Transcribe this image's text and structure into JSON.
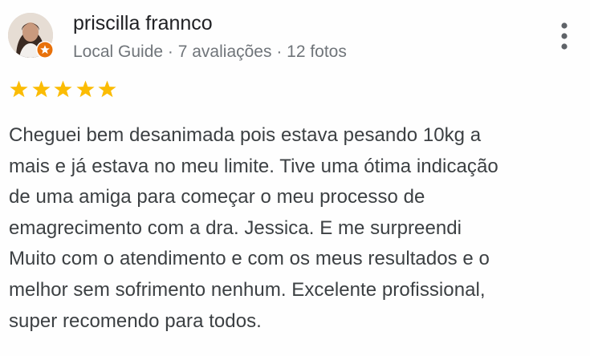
{
  "review": {
    "author_name": "priscilla frannco",
    "author_meta": "Local Guide · 7 avaliações · 12 fotos",
    "rating": 5,
    "rating_max": 5,
    "text": "Cheguei bem desanimada pois estava pesando 10kg a\nmais e já estava no meu limite. Tive uma ótima indicação\nde uma amiga para começar o meu processo de\nemagrecimento com a dra. Jessica. E me surpreendi\nMuito com o atendimento e com os meus resultados e o\nmelhor sem sofrimento nenhum. Excelente profissional,\nsuper recomendo para todos."
  },
  "icons": {
    "avatar": "profile-photo",
    "badge": "local-guide-star-badge",
    "menu": "more-vertical-icon",
    "star": "star-icon"
  },
  "colors": {
    "star": "#fbbc04",
    "badge": "#e8710a",
    "name": "#202124",
    "meta": "#70757a",
    "text": "#3c4043",
    "menu": "#5f6368"
  }
}
